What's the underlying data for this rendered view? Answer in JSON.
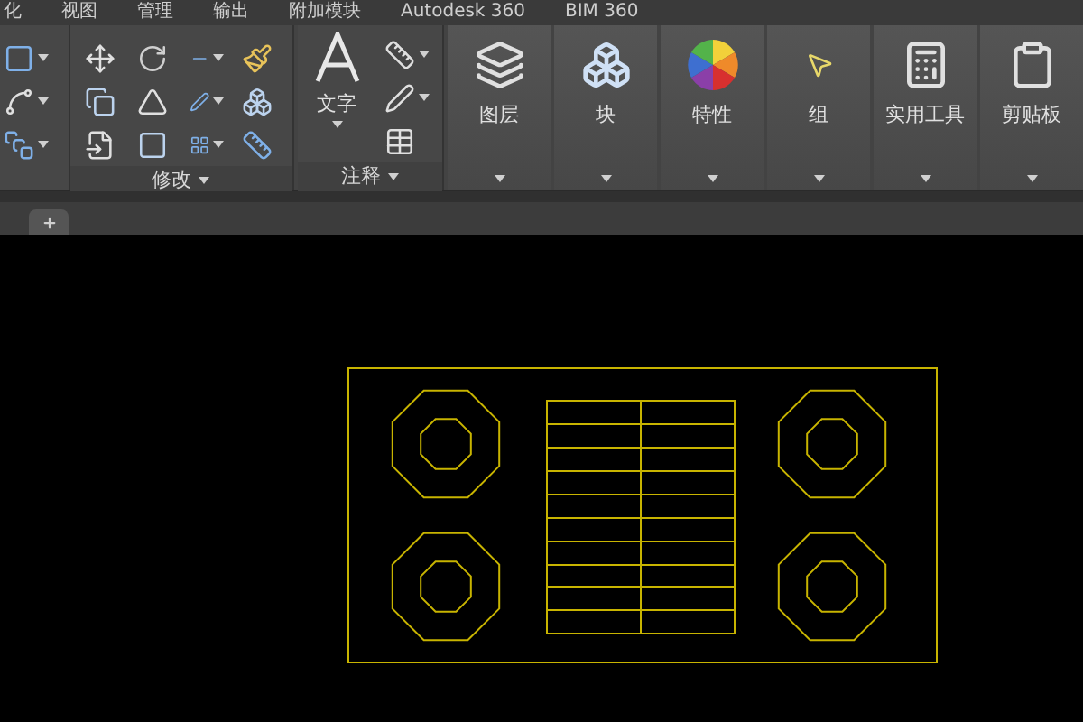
{
  "menu_tabs": [
    {
      "label": "化"
    },
    {
      "label": "视图"
    },
    {
      "label": "管理"
    },
    {
      "label": "输出"
    },
    {
      "label": "附加模块"
    },
    {
      "label": "Autodesk 360"
    },
    {
      "label": "BIM 360"
    }
  ],
  "modify_panel": {
    "title": "修改"
  },
  "annotate_panel": {
    "title": "注释",
    "text_button": "文字"
  },
  "big_panels": [
    {
      "kind": "layers",
      "label": "图层"
    },
    {
      "kind": "block",
      "label": "块"
    },
    {
      "kind": "properties",
      "label": "特性"
    },
    {
      "kind": "group",
      "label": "组"
    },
    {
      "kind": "utilities",
      "label": "实用工具"
    },
    {
      "kind": "clipboard",
      "label": "剪贴板"
    }
  ]
}
